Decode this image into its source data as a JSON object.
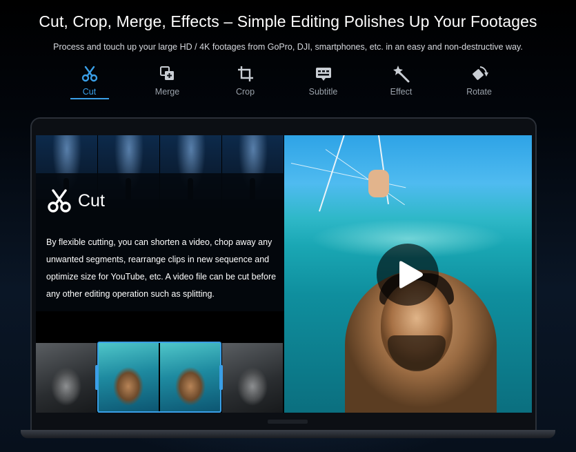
{
  "header": {
    "title": "Cut, Crop, Merge, Effects – Simple Editing Polishes Up Your Footages",
    "subtitle": "Process and touch up your large HD / 4K footages from GoPro, DJI, smartphones, etc. in an easy and non-destructive way."
  },
  "tabs": [
    {
      "label": "Cut",
      "icon": "scissors-icon",
      "active": true
    },
    {
      "label": "Merge",
      "icon": "merge-icon",
      "active": false
    },
    {
      "label": "Crop",
      "icon": "crop-icon",
      "active": false
    },
    {
      "label": "Subtitle",
      "icon": "subtitle-icon",
      "active": false
    },
    {
      "label": "Effect",
      "icon": "magic-wand-icon",
      "active": false
    },
    {
      "label": "Rotate",
      "icon": "rotate-icon",
      "active": false
    }
  ],
  "feature": {
    "title": "Cut",
    "icon": "scissors-icon",
    "description": "By flexible cutting, you can shorten a video, chop away any unwanted segments, rearrange clips in new sequence and optimize size for YouTube, etc. A video file can be cut before any other editing operation such as splitting."
  },
  "player": {
    "control": "play-icon"
  },
  "colors": {
    "accent": "#3a9fe7",
    "tab_inactive": "#9aa1aa",
    "background": "#000000"
  }
}
